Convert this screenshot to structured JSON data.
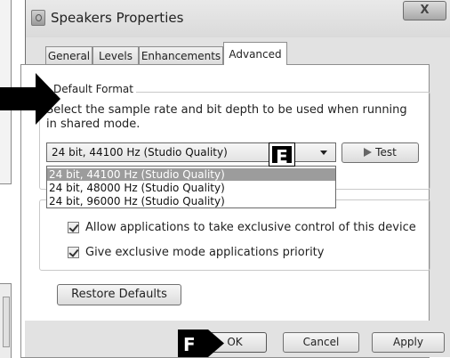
{
  "window": {
    "title": "Speakers Properties",
    "close_label": "X"
  },
  "tabs": [
    {
      "label": "General"
    },
    {
      "label": "Levels"
    },
    {
      "label": "Enhancements"
    },
    {
      "label": "Advanced",
      "active": true
    }
  ],
  "default_format": {
    "group_label": "Default Format",
    "description": "Select the sample rate and bit depth to be used when running in shared mode.",
    "selected_value": "24 bit, 44100 Hz (Studio Quality)",
    "options": [
      "24 bit, 44100 Hz (Studio Quality)",
      "24 bit, 48000 Hz (Studio Quality)",
      "24 bit, 96000 Hz (Studio Quality)"
    ],
    "test_label": "Test"
  },
  "exclusive_mode": {
    "group_label_visible": "E",
    "options": [
      {
        "label": "Allow applications to take exclusive control of this device",
        "checked": true
      },
      {
        "label": "Give exclusive mode applications priority",
        "checked": true
      }
    ]
  },
  "restore_defaults_label": "Restore Defaults",
  "buttons": {
    "ok": "OK",
    "cancel": "Cancel",
    "apply": "Apply"
  },
  "callouts": {
    "e": "E",
    "f": "F"
  }
}
